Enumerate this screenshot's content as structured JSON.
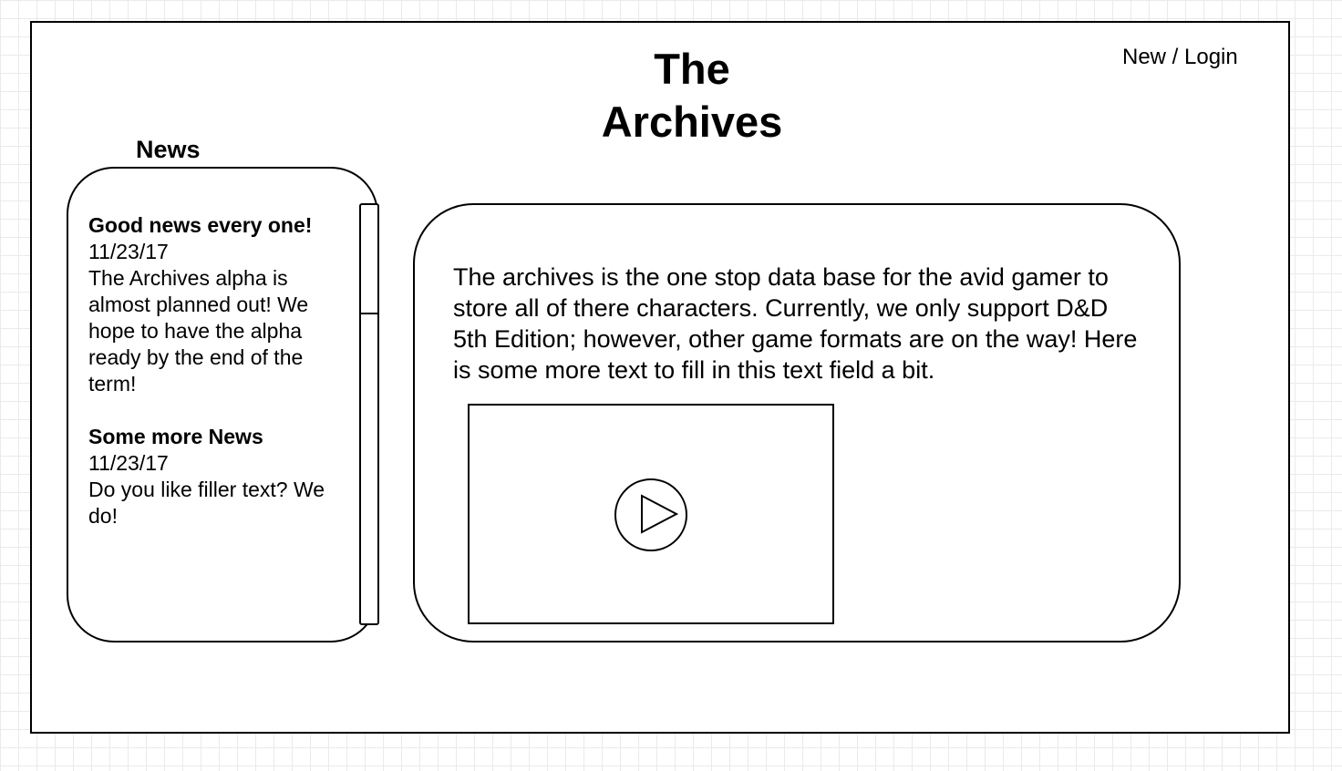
{
  "header": {
    "title": "The Archives",
    "login_label": "New / Login"
  },
  "news": {
    "heading": "News",
    "items": [
      {
        "title": "Good news every one!",
        "date": "11/23/17",
        "body": "The Archives alpha is almost planned out! We hope to have the alpha ready by the end of the term!"
      },
      {
        "title": "Some more News",
        "date": "11/23/17",
        "body": "Do you like filler text? We do!"
      }
    ]
  },
  "main": {
    "description": "The archives is the one stop data base for the avid gamer to store all of there characters. Currently, we only support D&D 5th Edition; however, other game formats are on the way! Here is some more text to fill in this text field a bit."
  },
  "video": {
    "icon": "play-icon"
  }
}
